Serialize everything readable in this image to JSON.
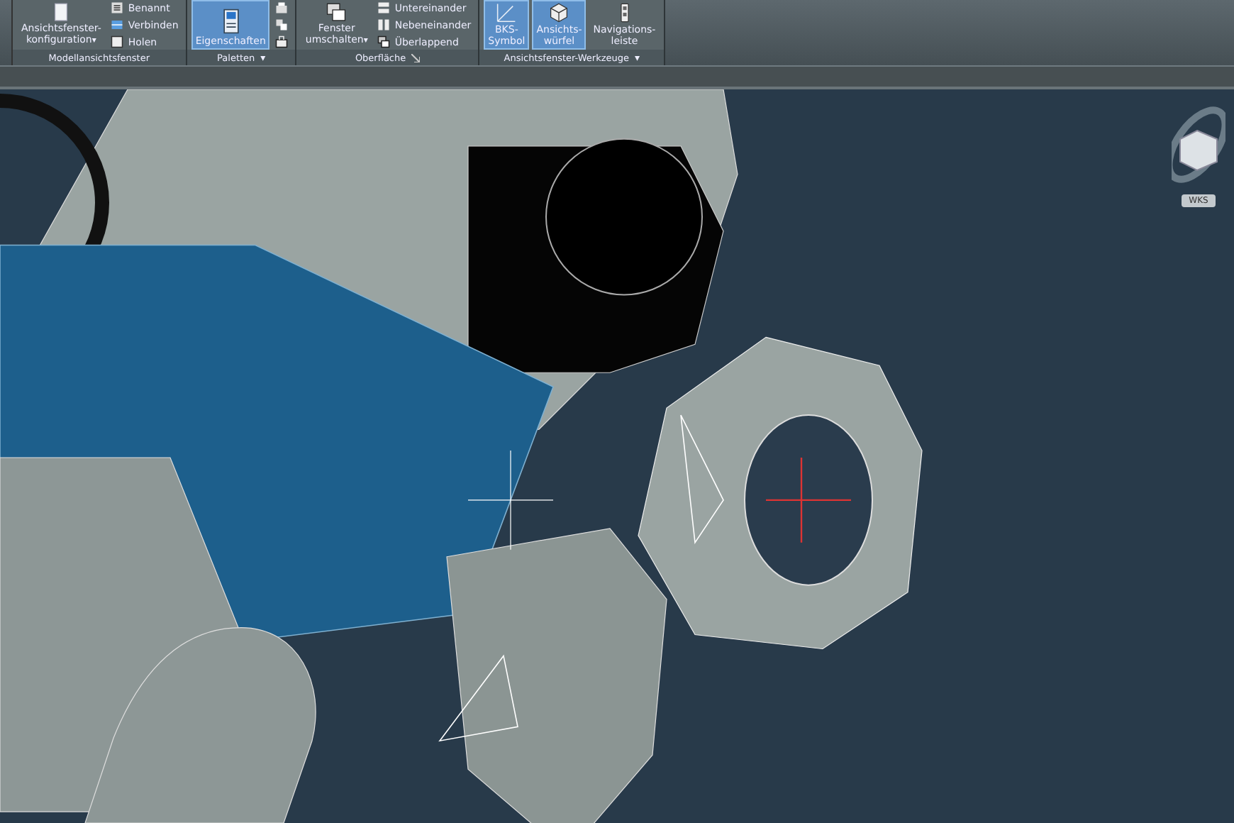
{
  "ribbon": {
    "panels": [
      {
        "title": "Modellansichtsfenster",
        "has_launcher": false,
        "large": [
          {
            "label": "Ansichtsfenster-\nkonfiguration",
            "selected": false,
            "caret": "▾"
          }
        ],
        "small": [
          {
            "label": "Benannt"
          },
          {
            "label": "Verbinden"
          },
          {
            "label": "Holen"
          }
        ]
      },
      {
        "title": "Paletten",
        "caret": "▾",
        "has_launcher": false,
        "large": [
          {
            "label": "Eigenschaften",
            "selected": true
          }
        ]
      },
      {
        "title": "Oberfläche",
        "has_launcher": true,
        "large": [
          {
            "label": "Fenster\numschalten",
            "selected": false,
            "caret": "▾"
          }
        ],
        "small": [
          {
            "label": "Untereinander"
          },
          {
            "label": "Nebeneinander"
          },
          {
            "label": "Überlappend"
          }
        ]
      },
      {
        "title": "Ansichtsfenster-Werkzeuge",
        "caret": "▾",
        "has_launcher": false,
        "large": [
          {
            "label": "BKS-\nSymbol",
            "selected": true
          },
          {
            "label": "Ansichts-\nwürfel",
            "selected": true
          },
          {
            "label": "Navigations-\nleiste",
            "selected": false
          }
        ]
      }
    ]
  },
  "viewport": {
    "viewcube_label": "WKS"
  }
}
